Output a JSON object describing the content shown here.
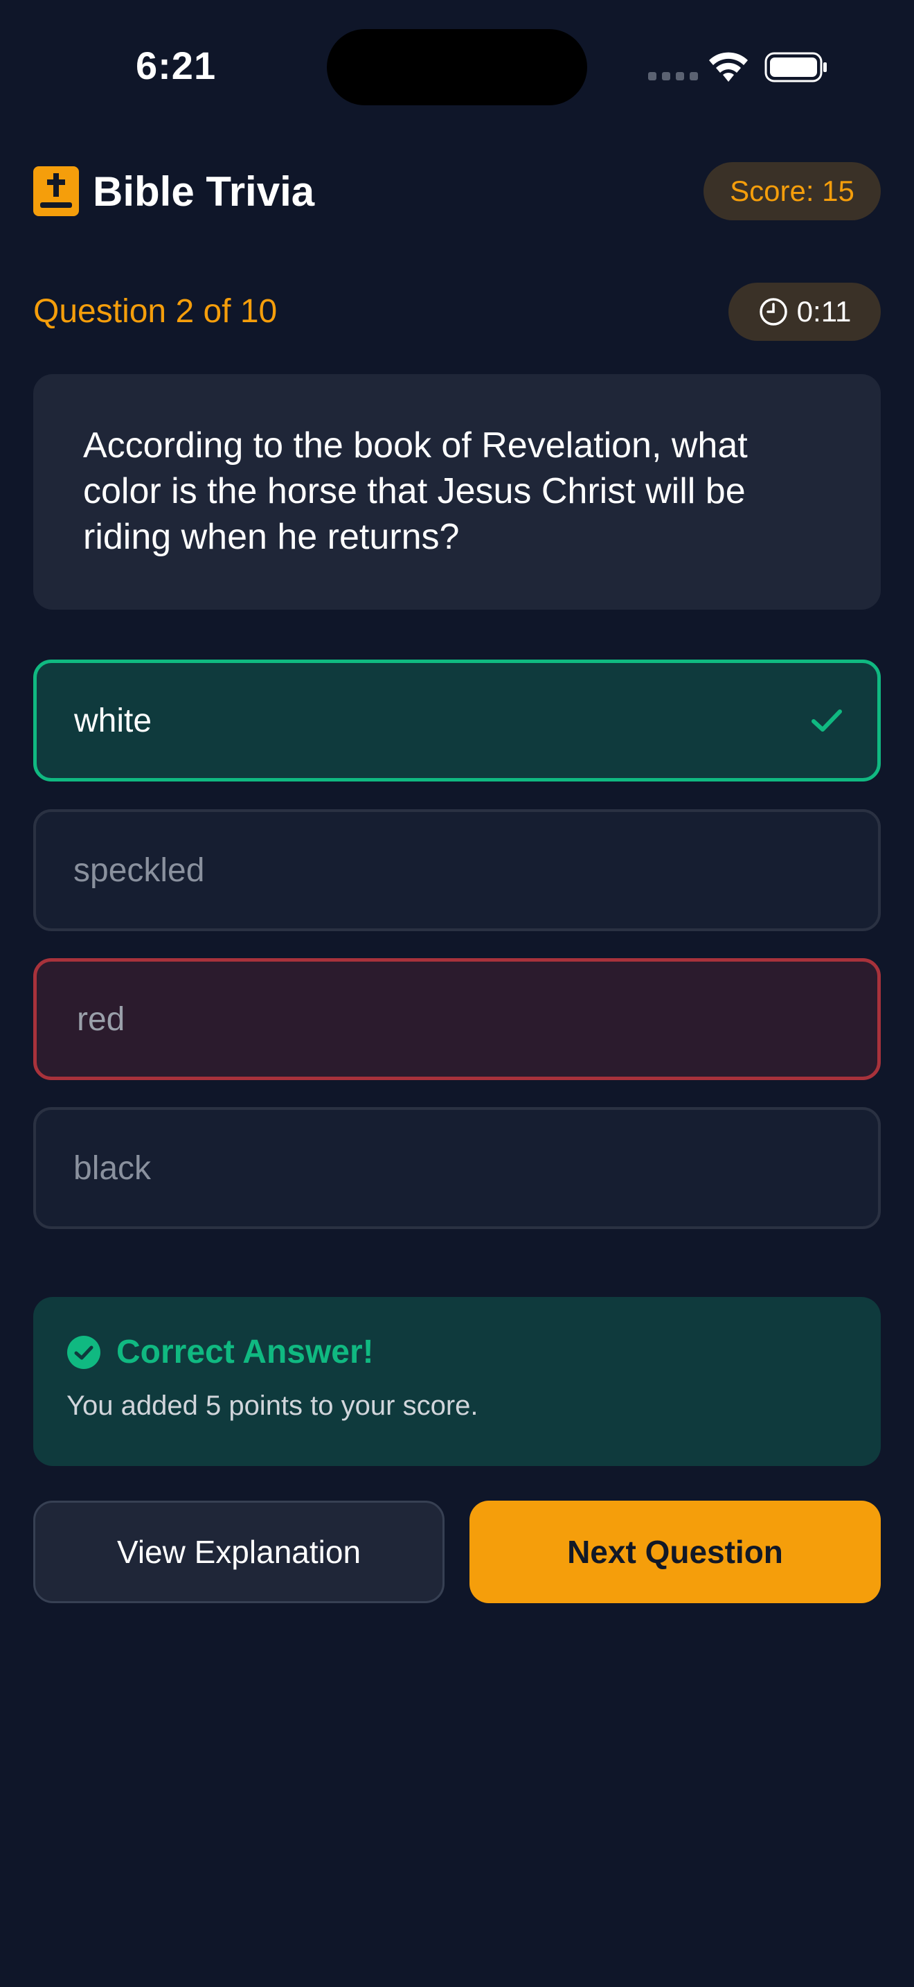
{
  "status_bar": {
    "time": "6:21"
  },
  "header": {
    "title": "Bible Trivia",
    "score_label": "Score: 15",
    "icon": "bible-icon"
  },
  "quiz": {
    "progress_label": "Question 2 of 10",
    "timer": "0:11",
    "question": "According to the book of Revelation, what color is the horse that Jesus Christ will be riding when he returns?",
    "options": [
      {
        "label": "white",
        "state": "correct"
      },
      {
        "label": "speckled",
        "state": "neutral"
      },
      {
        "label": "red",
        "state": "wrong"
      },
      {
        "label": "black",
        "state": "neutral"
      }
    ]
  },
  "feedback": {
    "title": "Correct Answer!",
    "message": "You added 5 points to your score."
  },
  "actions": {
    "explanation_label": "View Explanation",
    "next_label": "Next Question"
  },
  "colors": {
    "background": "#0f1629",
    "accent": "#f59e0b",
    "correct": "#10b981",
    "wrong": "#a8323b",
    "card": "#1f2638"
  }
}
